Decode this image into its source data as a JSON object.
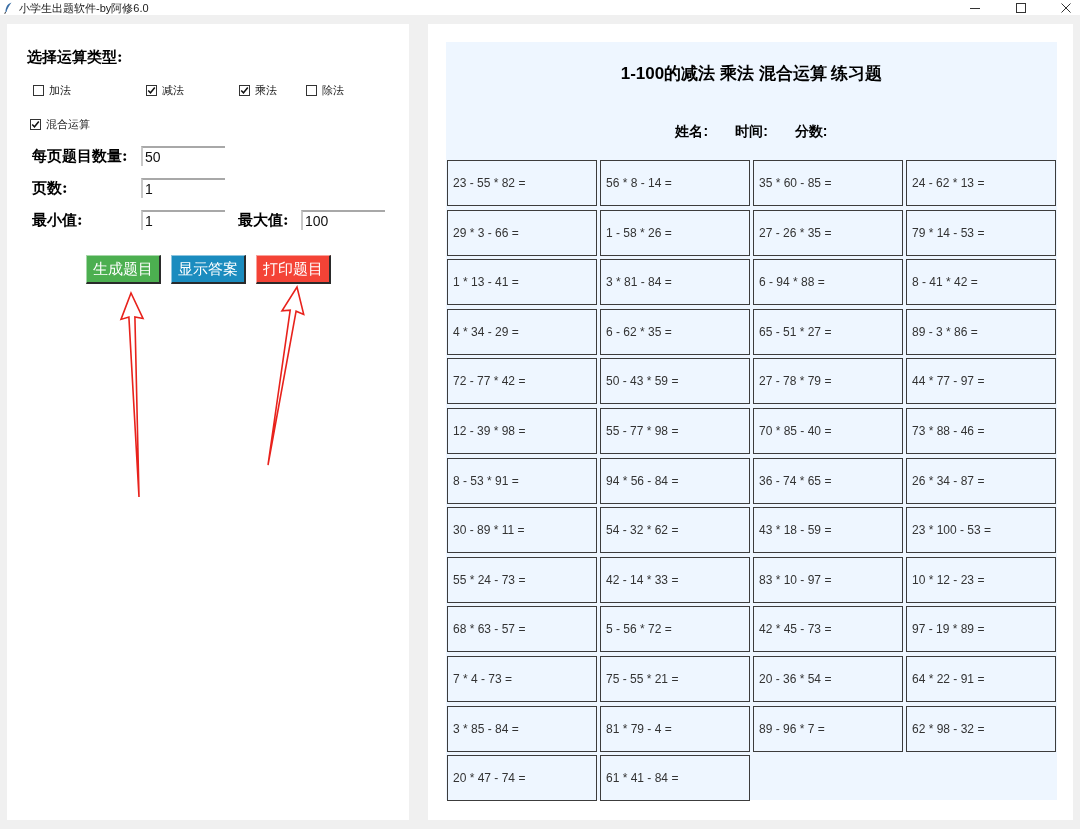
{
  "window": {
    "title": "小学生出题软件-by阿修6.0"
  },
  "settings": {
    "heading": "选择运算类型:",
    "operation_rows": [
      [
        {
          "label": "加法",
          "checked": false
        },
        {
          "label": "减法",
          "checked": true
        },
        {
          "label": "乘法",
          "checked": true
        },
        {
          "label": "除法",
          "checked": false
        }
      ],
      [
        {
          "label": "混合运算",
          "checked": true
        }
      ]
    ],
    "field_rows": [
      [
        {
          "label": "每页题目数量:",
          "value": "50"
        }
      ],
      [
        {
          "label": "页数:",
          "value": "1"
        }
      ],
      [
        {
          "label": "最小值:",
          "value": "1"
        },
        {
          "label": "最大值:",
          "value": "100"
        }
      ]
    ],
    "buttons": [
      {
        "label": "生成题目",
        "color": "#4caf50"
      },
      {
        "label": "显示答案",
        "color": "#1b8cbf"
      },
      {
        "label": "打印题目",
        "color": "#f44336"
      }
    ]
  },
  "annotations": [
    {
      "kind": "arrow"
    },
    {
      "kind": "arrow"
    }
  ],
  "worksheet": {
    "title": "1-100的减法 乘法 混合运算 练习题",
    "info_labels": [
      "姓名:",
      "时间:",
      "分数:"
    ],
    "problems": [
      "23 - 55 * 82 =",
      "56 * 8 - 14 =",
      "35 * 60 - 85 =",
      "24 - 62 * 13 =",
      "29 * 3 - 66 =",
      "1 - 58 * 26 =",
      "27 - 26 * 35 =",
      "79 * 14 - 53 =",
      "1 * 13 - 41 =",
      "3 * 81 - 84 =",
      "6 - 94 * 88 =",
      "8 - 41 * 42 =",
      "4 * 34 - 29 =",
      "6 - 62 * 35 =",
      "65 - 51 * 27 =",
      "89 - 3 * 86 =",
      "72 - 77 * 42 =",
      "50 - 43 * 59 =",
      "27 - 78 * 79 =",
      "44 * 77 - 97 =",
      "12 - 39 * 98 =",
      "55 - 77 * 98 =",
      "70 * 85 - 40 =",
      "73 * 88 - 46 =",
      "8 - 53 * 91 =",
      "94 * 56 - 84 =",
      "36 - 74 * 65 =",
      "26 * 34 - 87 =",
      "30 - 89 * 11 =",
      "54 - 32 * 62 =",
      "43 * 18 - 59 =",
      "23 * 100 - 53 =",
      "55 * 24 - 73 =",
      "42 - 14 * 33 =",
      "83 * 10 - 97 =",
      "10 * 12 - 23 =",
      "68 * 63 - 57 =",
      "5 - 56 * 72 =",
      "42 * 45 - 73 =",
      "97 - 19 * 89 =",
      "7 * 4 - 73 =",
      "75 - 55 * 21 =",
      "20 - 36 * 54 =",
      "64 * 22 - 91 =",
      "3 * 85 - 84 =",
      "81 * 79 - 4 =",
      "89 - 96 * 7 =",
      "62 * 98 - 32 =",
      "20 * 47 - 74 =",
      "61 * 41 - 84 ="
    ]
  }
}
